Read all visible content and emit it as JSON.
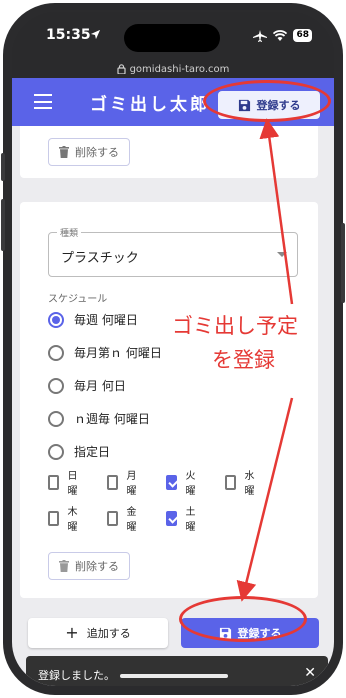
{
  "status_bar": {
    "time": "15:35",
    "battery": "68"
  },
  "browser": {
    "url": "gomidashi-taro.com"
  },
  "app_bar": {
    "title": "ゴミ出し太郎",
    "register_label": "登録する"
  },
  "top_card": {
    "delete_label": "削除する"
  },
  "form": {
    "type_label": "種類",
    "type_value": "プラスチック",
    "schedule_label": "スケジュール",
    "schedule_options": [
      {
        "label": "毎週 何曜日",
        "selected": true
      },
      {
        "label": "毎月第ｎ 何曜日",
        "selected": false
      },
      {
        "label": "毎月 何日",
        "selected": false
      },
      {
        "label": "ｎ週毎 何曜日",
        "selected": false
      },
      {
        "label": "指定日",
        "selected": false
      }
    ],
    "weekdays": [
      {
        "label": "日曜",
        "checked": false
      },
      {
        "label": "月曜",
        "checked": false
      },
      {
        "label": "火曜",
        "checked": true
      },
      {
        "label": "水曜",
        "checked": false
      },
      {
        "label": "木曜",
        "checked": false
      },
      {
        "label": "金曜",
        "checked": false
      },
      {
        "label": "土曜",
        "checked": true
      }
    ],
    "delete_label": "削除する"
  },
  "actions": {
    "add_label": "追加する",
    "register_label": "登録する"
  },
  "snackbar": {
    "message": "登録しました。"
  },
  "annotation": {
    "line1": "ゴミ出し予定",
    "line2": "を登録"
  },
  "colors": {
    "primary": "#5a63e8",
    "annotation": "#e53935"
  },
  "icons": [
    "location-arrow-icon",
    "airplane-icon",
    "wifi-icon",
    "lock-icon",
    "menu-icon",
    "save-icon",
    "trash-icon",
    "plus-icon",
    "close-icon"
  ]
}
